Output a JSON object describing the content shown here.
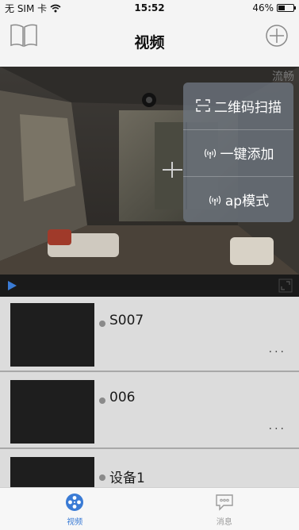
{
  "status_bar": {
    "carrier": "无 SIM 卡",
    "time": "15:52",
    "battery": "46%",
    "battery_level": 0.46
  },
  "nav": {
    "title": "视频",
    "left_icon": "book-icon",
    "right_icon": "plus-circle-icon"
  },
  "preview": {
    "watermark": "流畅"
  },
  "popover": {
    "items": [
      {
        "label": "二维码扫描",
        "icon": "qr-scan-icon"
      },
      {
        "label": "一键添加",
        "icon": "wireless-icon"
      },
      {
        "label": "ap模式",
        "icon": "wireless-icon"
      }
    ]
  },
  "devices": [
    {
      "name": "S007",
      "more": "..."
    },
    {
      "name": "006",
      "more": "..."
    },
    {
      "name": "设备1",
      "more": "..."
    }
  ],
  "tabbar": {
    "tabs": [
      {
        "label": "视频",
        "icon": "film-reel-icon",
        "active": true
      },
      {
        "label": "消息",
        "icon": "chat-bubble-icon",
        "active": false
      }
    ]
  },
  "colors": {
    "accent": "#3a7bd5",
    "popover_bg": "#6e7680"
  }
}
